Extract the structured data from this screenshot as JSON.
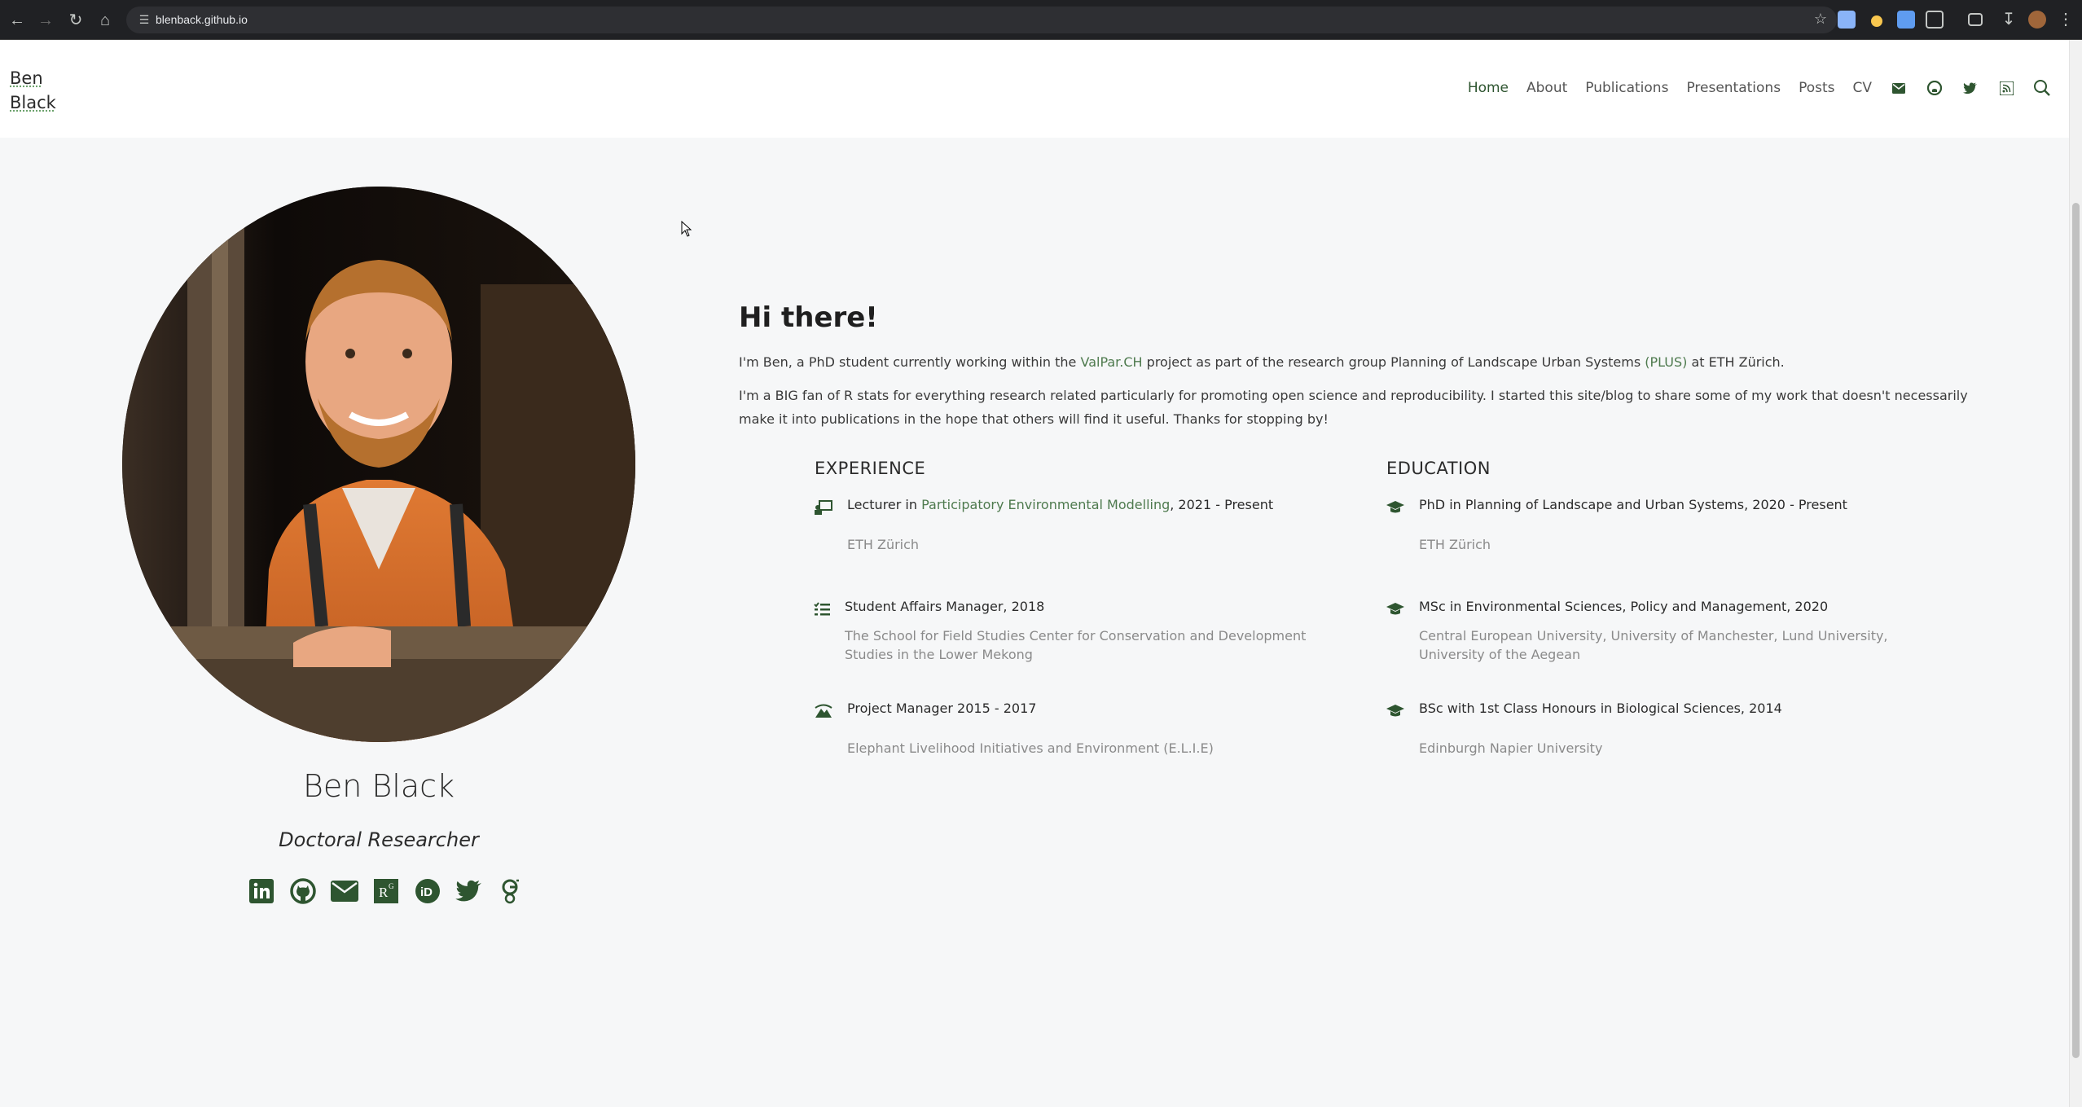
{
  "browser": {
    "url": "blenback.github.io"
  },
  "header": {
    "brand_line1": "Ben",
    "brand_line2": "Black",
    "nav": [
      {
        "label": "Home"
      },
      {
        "label": "About"
      },
      {
        "label": "Publications"
      },
      {
        "label": "Presentations"
      },
      {
        "label": "Posts"
      },
      {
        "label": "CV"
      }
    ],
    "nav_icons": [
      "envelope-icon",
      "github-icon",
      "twitter-icon",
      "rss-icon",
      "search-icon"
    ]
  },
  "profile": {
    "name": "Ben Black",
    "role": "Doctoral Researcher",
    "social_icons": [
      "linkedin-icon",
      "github-icon",
      "envelope-icon",
      "researchgate-icon",
      "orcid-icon",
      "twitter-icon",
      "google-scholar-icon"
    ]
  },
  "intro": {
    "title": "Hi there!",
    "p1_a": "I'm Ben, a PhD student currently working within the ",
    "p1_link1": "ValPar.CH",
    "p1_b": " project as part of the research group Planning of Landscape Urban Systems ",
    "p1_link2": "(PLUS)",
    "p1_c": " at ETH Zürich.",
    "p2": "I'm a BIG fan of R stats for everything research related particularly for promoting open science and reproducibility. I started this site/blog to share some of my work that doesn't necessarily make it into publications in the hope that others will find it useful. Thanks for stopping by!"
  },
  "experience": {
    "title": "EXPERIENCE",
    "items": [
      {
        "title_a": "Lecturer in ",
        "title_link": "Participatory Environmental Modelling",
        "title_b": ", 2021 - Present",
        "sub": "ETH Zürich",
        "icon": "teacher-icon"
      },
      {
        "title": "Student Affairs Manager, 2018",
        "sub": "The School for Field Studies Center for Conservation and Development Studies in the Lower Mekong",
        "icon": "list-icon"
      },
      {
        "title": "Project Manager 2015 - 2017",
        "sub": "Elephant Livelihood Initiatives and Environment (E.L.I.E)",
        "icon": "mountain-icon"
      }
    ]
  },
  "education": {
    "title": "EDUCATION",
    "items": [
      {
        "title": "PhD in Planning of Landscape and Urban Systems, 2020 - Present",
        "sub": "ETH Zürich",
        "icon": "graduation-cap-icon"
      },
      {
        "title": "MSc in Environmental Sciences, Policy and Management, 2020",
        "sub": "Central European University, University of Manchester, Lund University, University of the Aegean",
        "icon": "graduation-cap-icon"
      },
      {
        "title": "BSc with 1st Class Honours in Biological Sciences, 2014",
        "sub": "Edinburgh Napier University",
        "icon": "graduation-cap-icon"
      }
    ]
  },
  "colors": {
    "accent": "#2e5530",
    "link": "#4e7a4e",
    "background": "#f6f7f8"
  }
}
